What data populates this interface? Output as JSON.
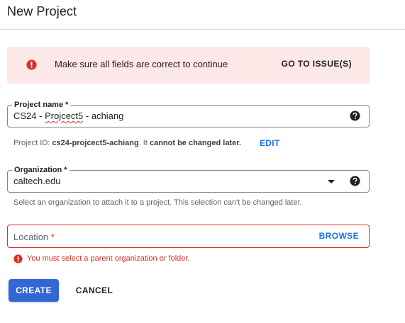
{
  "page": {
    "title": "New Project"
  },
  "banner": {
    "message": "Make sure all fields are correct to continue",
    "action_label": "GO TO ISSUE(S)",
    "icon": "error-icon",
    "color": "#d93025"
  },
  "project_name": {
    "label": "Project name *",
    "value_prefix": "CS24 - ",
    "value_misspelled": "Projcect5",
    "value_suffix": " - achiang",
    "help_icon": "help-icon"
  },
  "project_id": {
    "prefix": "Project ID: ",
    "id": "cs24-projcect5-achiang",
    "middle": ". It ",
    "emphasis": "cannot be changed later.",
    "edit_label": "EDIT"
  },
  "organization": {
    "label": "Organization *",
    "value": "caltech.edu",
    "hint": "Select an organization to attach it to a project. This selection can't be changed later.",
    "help_icon": "help-icon"
  },
  "location": {
    "placeholder": "Location ",
    "required_mark": "*",
    "browse_label": "BROWSE",
    "error": "You must select a parent organization or folder."
  },
  "actions": {
    "create_label": "CREATE",
    "cancel_label": "CANCEL"
  },
  "colors": {
    "accent": "#1a73e8",
    "primary_button": "#3367d6",
    "error": "#d93025",
    "banner_bg": "#fce8e6"
  }
}
